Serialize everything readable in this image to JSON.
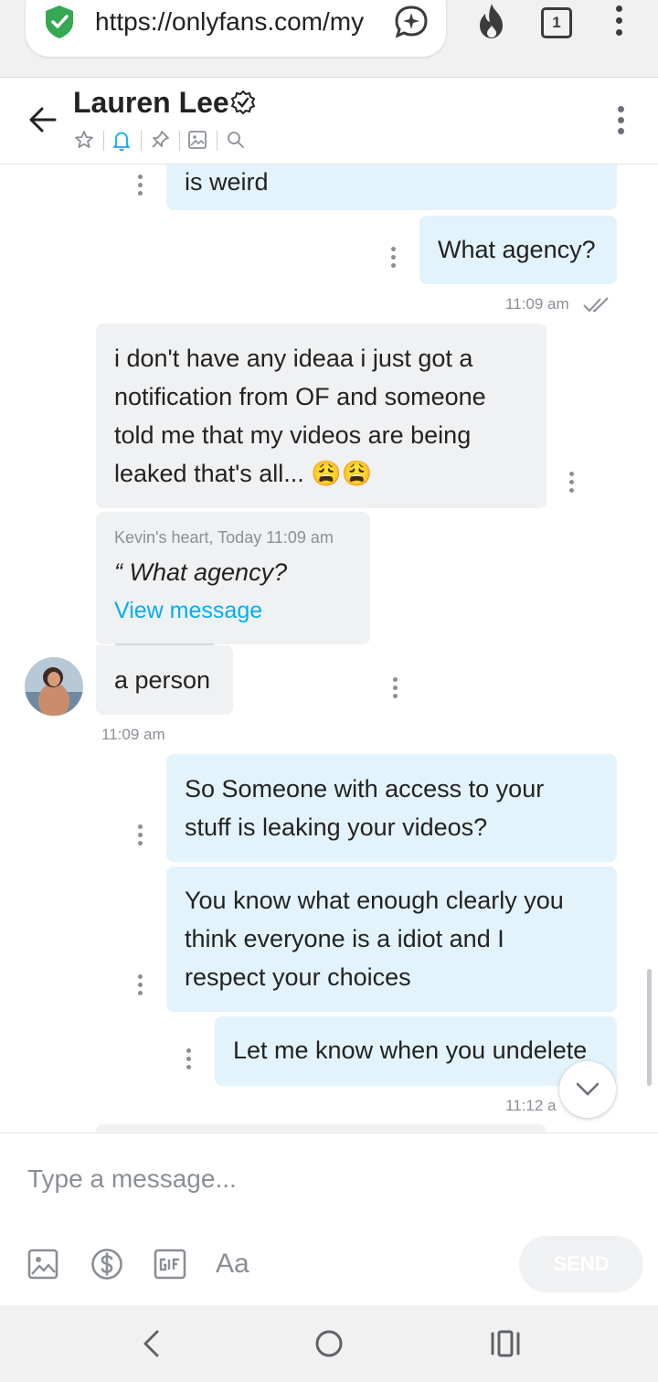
{
  "browser": {
    "url": "https://onlyfans.com/my",
    "tab_count": "1"
  },
  "header": {
    "title": "Lauren Lee"
  },
  "messages": {
    "m1_text": "is weird",
    "m2_text": "What agency?",
    "m2_time": "11:09 am",
    "m3_lines": [
      "i don't have any ideaa i just got a",
      "notification from OF and someone",
      "told me that my videos are being",
      "leaked that's all... 😩😩"
    ],
    "reply_author": "Kevin's heart, Today 11:09 am",
    "reply_quote": "“ What agency?",
    "reply_link": "View message",
    "m4_text": "a person",
    "m4_time": "11:09 am",
    "m5_lines": [
      "So Someone with access to your",
      "stuff is leaking your videos?"
    ],
    "m6_lines": [
      "You know what enough clearly you",
      "think everyone is a idiot and I",
      "respect your choices"
    ],
    "m7_text": "Let me know when you undelete",
    "m7_time": "11:12 a"
  },
  "composer": {
    "placeholder": "Type a message...",
    "send_label": "SEND",
    "text_format_label": "Aa"
  },
  "colors": {
    "accent": "#00aff0",
    "outgoing_bubble": "#e3f3fb",
    "incoming_bubble": "#f0f1f3",
    "verified_green": "#34a853"
  }
}
